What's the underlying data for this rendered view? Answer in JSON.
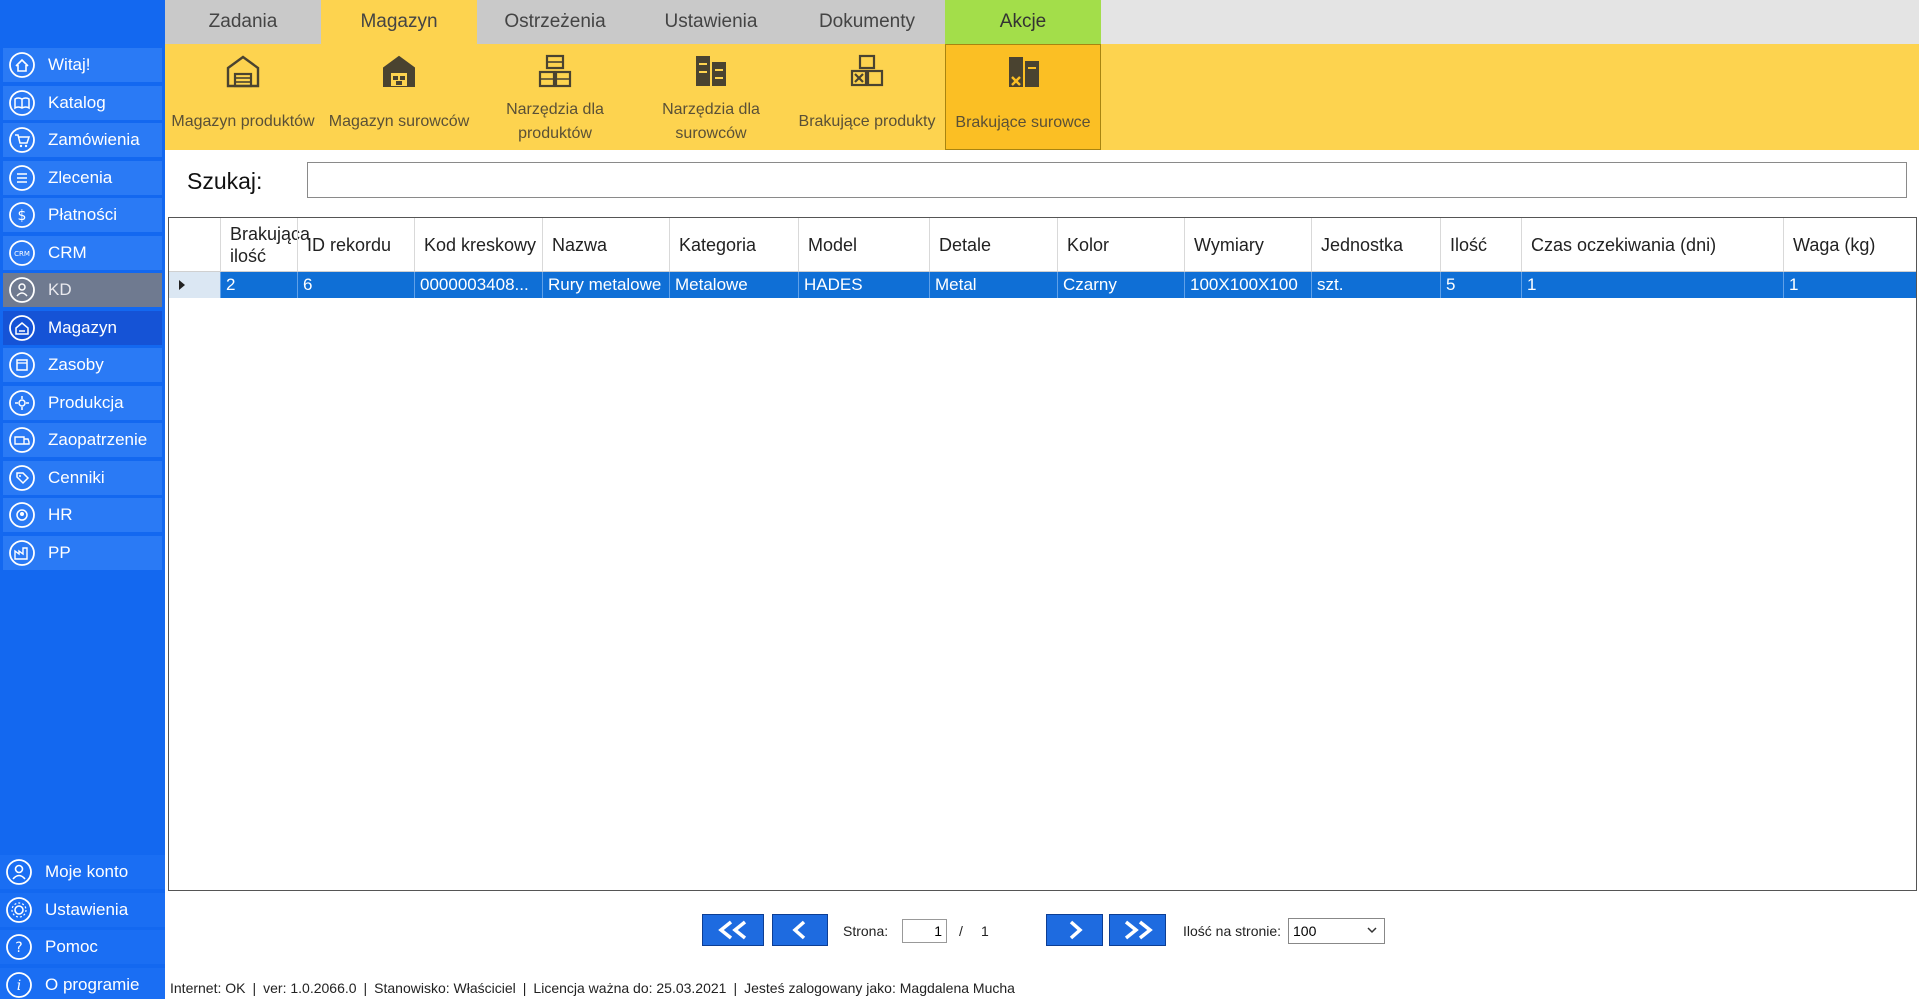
{
  "sidebar": {
    "items": [
      {
        "label": "Witaj!",
        "icon": "home-icon"
      },
      {
        "label": "Katalog",
        "icon": "book-icon"
      },
      {
        "label": "Zamówienia",
        "icon": "cart-icon"
      },
      {
        "label": "Zlecenia",
        "icon": "list-icon"
      },
      {
        "label": "Płatności",
        "icon": "dollar-icon"
      },
      {
        "label": "CRM",
        "icon": "crm-icon"
      },
      {
        "label": "KD",
        "icon": "user-badge-icon",
        "disabled": true
      },
      {
        "label": "Magazyn",
        "icon": "warehouse-icon",
        "active": true
      },
      {
        "label": "Zasoby",
        "icon": "box-icon"
      },
      {
        "label": "Produkcja",
        "icon": "gear-flower-icon"
      },
      {
        "label": "Zaopatrzenie",
        "icon": "truck-icon"
      },
      {
        "label": "Cenniki",
        "icon": "tag-icon"
      },
      {
        "label": "HR",
        "icon": "person-circle-icon"
      },
      {
        "label": "PP",
        "icon": "factory-icon"
      }
    ],
    "bottom": [
      {
        "label": "Moje konto",
        "icon": "account-icon"
      },
      {
        "label": "Ustawienia",
        "icon": "settings-icon"
      },
      {
        "label": "Pomoc",
        "icon": "help-icon"
      },
      {
        "label": "O programie",
        "icon": "info-icon"
      }
    ]
  },
  "tabs": [
    {
      "label": "Zadania"
    },
    {
      "label": "Magazyn",
      "active": true
    },
    {
      "label": "Ostrzeżenia"
    },
    {
      "label": "Ustawienia"
    },
    {
      "label": "Dokumenty"
    },
    {
      "label": "Akcje"
    }
  ],
  "ribbon": [
    {
      "label": "Magazyn produktów",
      "icon": "warehouse-products-icon"
    },
    {
      "label": "Magazyn surowców",
      "icon": "warehouse-materials-icon"
    },
    {
      "label": "Narzędzia dla produktów",
      "icon": "tools-products-icon"
    },
    {
      "label": "Narzędzia dla surowców",
      "icon": "tools-materials-icon"
    },
    {
      "label": "Brakujące produkty",
      "icon": "missing-products-icon"
    },
    {
      "label": "Brakujące surowce",
      "icon": "missing-materials-icon",
      "active": true
    }
  ],
  "search": {
    "label": "Szukaj:",
    "value": "",
    "placeholder": ""
  },
  "grid": {
    "columns": [
      "Brakująca ilość",
      "ID rekordu",
      "Kod kreskowy",
      "Nazwa",
      "Kategoria",
      "Model",
      "Detale",
      "Kolor",
      "Wymiary",
      "Jednostka",
      "Ilość",
      "Czas oczekiwania (dni)",
      "Waga (kg)"
    ],
    "rows": [
      [
        "2",
        "6",
        "0000003408...",
        "Rury metalowe",
        "Metalowe",
        "HADES",
        "Metal",
        "Czarny",
        "100X100X100",
        "szt.",
        "5",
        "1",
        "1"
      ]
    ]
  },
  "pager": {
    "page_label": "Strona:",
    "current_page": "1",
    "separator": "/",
    "total_pages": "1",
    "per_page_label": "Ilość na stronie:",
    "per_page_value": "100"
  },
  "status": {
    "internet": "Internet: OK",
    "version": "ver: 1.0.2066.0",
    "position": "Stanowisko: Właściciel",
    "license": "Licencja ważna do: 25.03.2021",
    "user": "Jesteś zalogowany jako: Magdalena Mucha"
  },
  "colors": {
    "sidebar": "#1368f0",
    "ribbon": "#fdd34f",
    "akcje_tab": "#a3de4a",
    "selected_row": "#0f6fd6"
  }
}
